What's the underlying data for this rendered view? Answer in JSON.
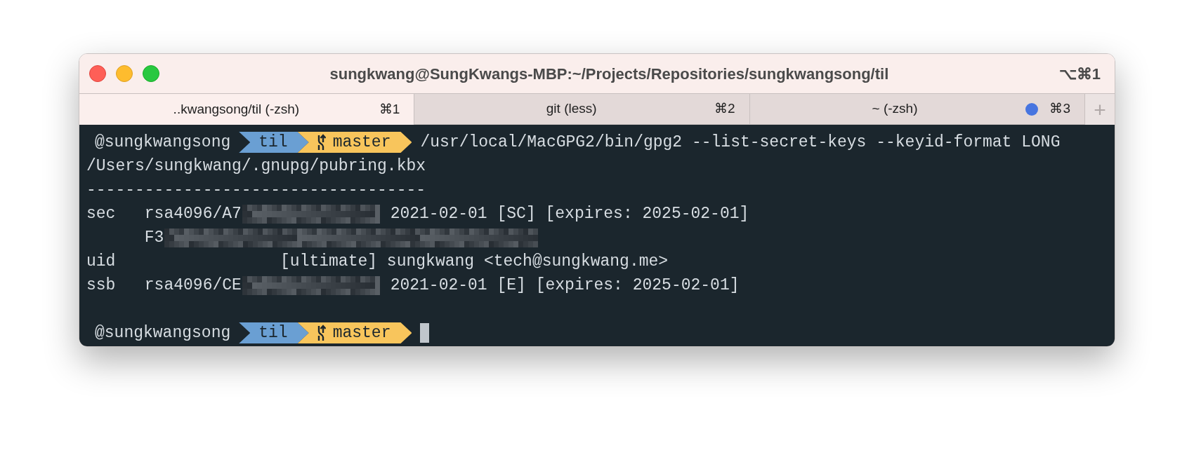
{
  "window": {
    "title": "sungkwang@SungKwangs-MBP:~/Projects/Repositories/sungkwangsong/til",
    "shortcut": "⌥⌘1"
  },
  "tabs": [
    {
      "label": "..kwangsong/til (-zsh)",
      "shortcut": "⌘1",
      "selected": true,
      "activity": false
    },
    {
      "label": "git (less)",
      "shortcut": "⌘2",
      "selected": false,
      "activity": false
    },
    {
      "label": "~ (-zsh)",
      "shortcut": "⌘3",
      "selected": false,
      "activity": true
    }
  ],
  "new_tab": {
    "label": "+"
  },
  "terminal": {
    "lines": [
      {
        "kind": "prompt",
        "user": "@sungkwangsong",
        "dir": "til",
        "branch": "master",
        "command": "/usr/local/MacGPG2/bin/gpg2 --list-secret-keys --keyid-format LONG"
      },
      {
        "kind": "text",
        "text": "/Users/sungkwang/.gnupg/pubring.kbx"
      },
      {
        "kind": "text",
        "text": "-----------------------------------"
      },
      {
        "kind": "key",
        "text": "sec   rsa4096/A7",
        "details": " 2021-02-01 [SC] [expires: 2025-02-01]"
      },
      {
        "kind": "fingerprint",
        "text": "      F3"
      },
      {
        "kind": "text",
        "text": "uid                 [ultimate] sungkwang <tech@sungkwang.me>"
      },
      {
        "kind": "key",
        "text": "ssb   rsa4096/CE",
        "details": " 2021-02-01 [E] [expires: 2025-02-01]"
      },
      {
        "kind": "blank"
      },
      {
        "kind": "prompt",
        "user": "@sungkwangsong",
        "dir": "til",
        "branch": "master",
        "cursor": true
      }
    ]
  }
}
